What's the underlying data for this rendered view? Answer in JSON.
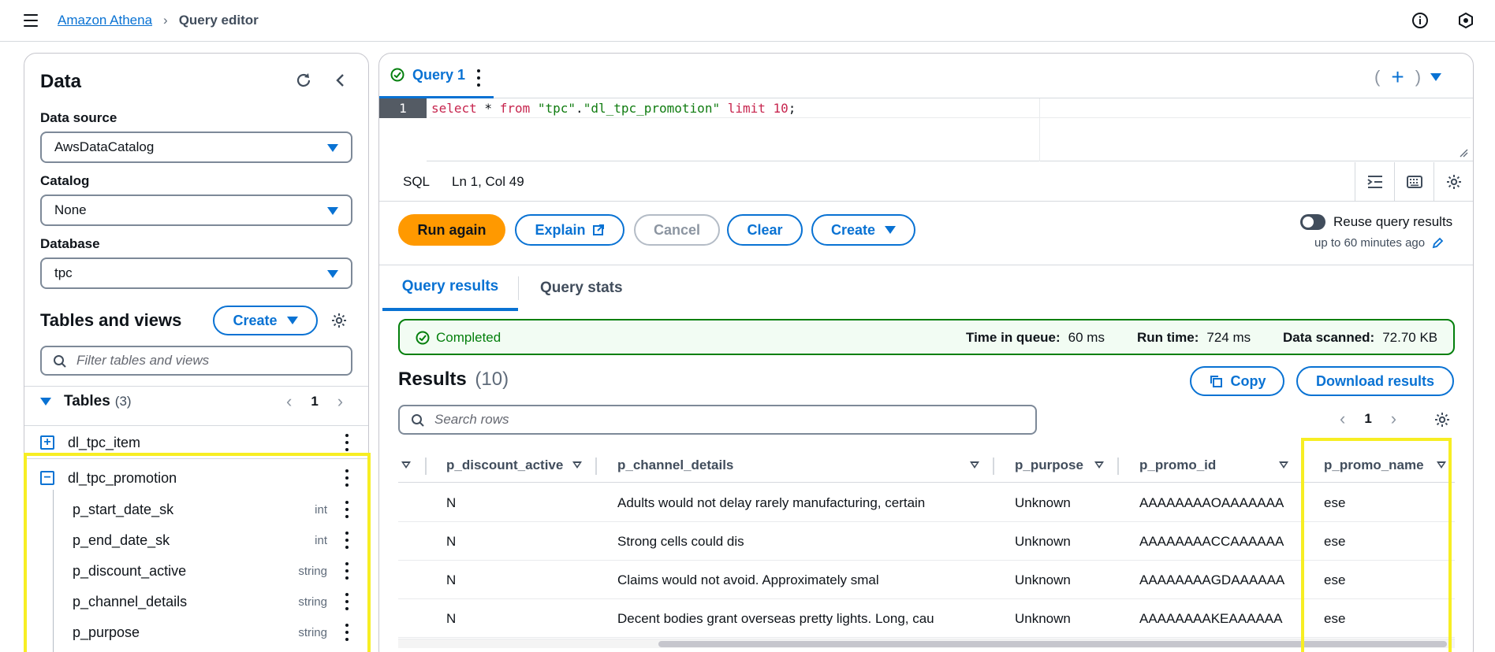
{
  "header": {
    "breadcrumb_root": "Amazon Athena",
    "breadcrumb_current": "Query editor"
  },
  "left": {
    "title": "Data",
    "data_source_label": "Data source",
    "data_source_value": "AwsDataCatalog",
    "catalog_label": "Catalog",
    "catalog_value": "None",
    "database_label": "Database",
    "database_value": "tpc",
    "tables_views_title": "Tables and views",
    "create_label": "Create",
    "filter_placeholder": "Filter tables and views",
    "tables_label": "Tables",
    "tables_count": "(3)",
    "page": "1",
    "tables": [
      {
        "name": "dl_tpc_item",
        "expander": "+"
      },
      {
        "name": "dl_tpc_promotion",
        "expander": "−"
      }
    ],
    "columns": [
      {
        "name": "p_start_date_sk",
        "type": "int"
      },
      {
        "name": "p_end_date_sk",
        "type": "int"
      },
      {
        "name": "p_discount_active",
        "type": "string"
      },
      {
        "name": "p_channel_details",
        "type": "string"
      },
      {
        "name": "p_purpose",
        "type": "string"
      }
    ]
  },
  "editor": {
    "tab_label": "Query 1",
    "line_number": "1",
    "code": {
      "kw_select": "select",
      "star": " * ",
      "kw_from": "from",
      "sp": " ",
      "db": "\"tpc\"",
      "dot": ".",
      "table": "\"dl_tpc_promotion\"",
      "kw_limit": " limit ",
      "limit_num": "10",
      "semi": ";"
    },
    "language": "SQL",
    "cursor_pos": "Ln 1, Col 49"
  },
  "actions": {
    "run_again": "Run again",
    "explain": "Explain",
    "cancel": "Cancel",
    "clear": "Clear",
    "create": "Create",
    "reuse_label": "Reuse query results",
    "reuse_sub": "up to 60 minutes ago"
  },
  "results_tabs": {
    "results": "Query results",
    "stats": "Query stats"
  },
  "status": {
    "state": "Completed",
    "time_in_queue_label": "Time in queue:",
    "time_in_queue": "60 ms",
    "run_time_label": "Run time:",
    "run_time": "724 ms",
    "data_scanned_label": "Data scanned:",
    "data_scanned": "72.70 KB"
  },
  "results": {
    "title": "Results",
    "count": "(10)",
    "copy_label": "Copy",
    "download_label": "Download results",
    "search_placeholder": "Search rows",
    "page": "1",
    "columns": [
      "p_discount_active",
      "p_channel_details",
      "p_purpose",
      "p_promo_id",
      "p_promo_name"
    ],
    "rows": [
      [
        "N",
        "Adults would not delay rarely manufacturing, certain",
        "Unknown",
        "AAAAAAAAOAAAAAAA",
        "ese"
      ],
      [
        "N",
        "Strong cells could dis",
        "Unknown",
        "AAAAAAAACCAAAAAA",
        "ese"
      ],
      [
        "N",
        "Claims would not avoid. Approximately smal",
        "Unknown",
        "AAAAAAAAGDAAAAAA",
        "ese"
      ],
      [
        "N",
        "Decent bodies grant overseas pretty lights. Long, cau",
        "Unknown",
        "AAAAAAAAKEAAAAAA",
        "ese"
      ]
    ]
  },
  "colors": {
    "accent": "#0972d3",
    "primary_button": "#ff9900",
    "success": "#037f0c",
    "highlight": "#f7ee23"
  }
}
